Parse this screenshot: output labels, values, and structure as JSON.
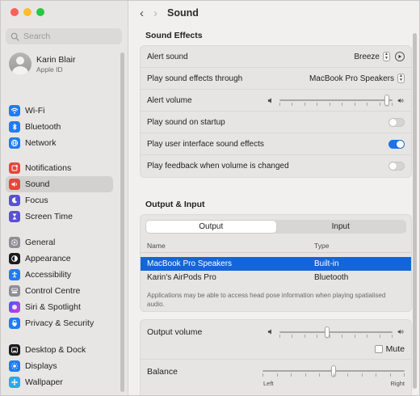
{
  "window": {
    "title": "Sound"
  },
  "sidebar": {
    "search_placeholder": "Search",
    "account": {
      "name": "Karin Blair",
      "subtitle": "Apple ID"
    },
    "groups": [
      [
        {
          "label": "Wi-Fi",
          "icon": "wifi-icon",
          "color": "#1f7cf2"
        },
        {
          "label": "Bluetooth",
          "icon": "bluetooth-icon",
          "color": "#1f7cf2"
        },
        {
          "label": "Network",
          "icon": "network-icon",
          "color": "#1f7cf2"
        }
      ],
      [
        {
          "label": "Notifications",
          "icon": "notifications-icon",
          "color": "#e8453c"
        },
        {
          "label": "Sound",
          "icon": "sound-icon",
          "color": "#e8453c",
          "selected": true
        },
        {
          "label": "Focus",
          "icon": "focus-icon",
          "color": "#5b4fd6"
        },
        {
          "label": "Screen Time",
          "icon": "screen-time-icon",
          "color": "#5b4fd6"
        }
      ],
      [
        {
          "label": "General",
          "icon": "general-icon",
          "color": "#8e8e93"
        },
        {
          "label": "Appearance",
          "icon": "appearance-icon",
          "color": "#1c1c1e"
        },
        {
          "label": "Accessibility",
          "icon": "accessibility-icon",
          "color": "#1f7cf2"
        },
        {
          "label": "Control Centre",
          "icon": "control-centre-icon",
          "color": "#8e8e93"
        },
        {
          "label": "Siri & Spotlight",
          "icon": "siri-icon",
          "color": "#7a3fe4"
        },
        {
          "label": "Privacy & Security",
          "icon": "privacy-icon",
          "color": "#1f7cf2"
        }
      ],
      [
        {
          "label": "Desktop & Dock",
          "icon": "desktop-dock-icon",
          "color": "#1c1c1e"
        },
        {
          "label": "Displays",
          "icon": "displays-icon",
          "color": "#1f7cf2"
        },
        {
          "label": "Wallpaper",
          "icon": "wallpaper-icon",
          "color": "#2aa8e8"
        }
      ]
    ]
  },
  "sound_effects": {
    "title": "Sound Effects",
    "alert_sound": {
      "label": "Alert sound",
      "value": "Breeze"
    },
    "play_through": {
      "label": "Play sound effects through",
      "value": "MacBook Pro Speakers"
    },
    "alert_volume": {
      "label": "Alert volume",
      "level": 0.97
    },
    "startup": {
      "label": "Play sound on startup",
      "on": false
    },
    "ui_sounds": {
      "label": "Play user interface sound effects",
      "on": true
    },
    "feedback": {
      "label": "Play feedback when volume is changed",
      "on": false
    }
  },
  "output_input": {
    "title": "Output & Input",
    "tabs": [
      "Output",
      "Input"
    ],
    "active_tab": "Output",
    "columns": [
      "Name",
      "Type"
    ],
    "devices": [
      {
        "name": "MacBook Pro Speakers",
        "type": "Built-in",
        "selected": true
      },
      {
        "name": "Karin's AirPods Pro",
        "type": "Bluetooth",
        "selected": false
      }
    ],
    "note": "Applications may be able to access head pose information when playing spatialised audio."
  },
  "output_volume": {
    "label": "Output volume",
    "level": 0.42,
    "mute_label": "Mute",
    "muted": false
  },
  "balance": {
    "label": "Balance",
    "level": 0.5,
    "left_label": "Left",
    "right_label": "Right"
  },
  "colors": {
    "accent": "#1a74e6",
    "selection": "#1565d8",
    "close": "#ff5f57",
    "minimize": "#febc2e",
    "zoom": "#28c840"
  }
}
